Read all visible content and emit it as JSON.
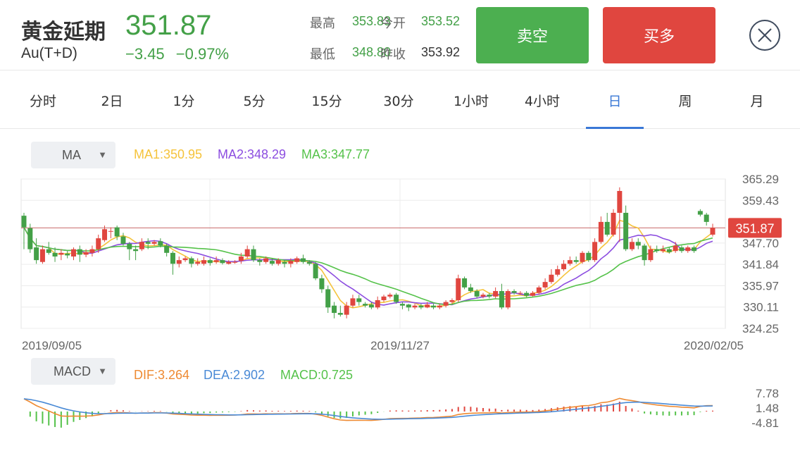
{
  "instrument": {
    "name": "黄金延期",
    "code": "Au(T+D)",
    "price": "351.87",
    "change": "−3.45",
    "change_pct": "−0.97%"
  },
  "stats": {
    "high_label": "最高",
    "high_value": "353.83",
    "open_label": "今开",
    "open_value": "353.52",
    "low_label": "最低",
    "low_value": "348.80",
    "prev_close_label": "昨收",
    "prev_close_value": "353.92"
  },
  "actions": {
    "sell_label": "卖空",
    "buy_label": "买多"
  },
  "tabs": [
    {
      "label": "分时"
    },
    {
      "label": "2日"
    },
    {
      "label": "1分"
    },
    {
      "label": "5分"
    },
    {
      "label": "15分"
    },
    {
      "label": "30分"
    },
    {
      "label": "1小时"
    },
    {
      "label": "4小时"
    },
    {
      "label": "日",
      "active": true
    },
    {
      "label": "周"
    },
    {
      "label": "月"
    }
  ],
  "ma_panel": {
    "selector": "MA",
    "ma1": "MA1:350.95",
    "ma2": "MA2:348.29",
    "ma3": "MA3:347.77",
    "y_ticks": [
      "365.29",
      "359.43",
      "347.70",
      "341.84",
      "335.97",
      "330.11",
      "324.25"
    ],
    "last_price_tag": "351.87",
    "dates": [
      "2019/09/05",
      "2019/11/27",
      "2020/02/05"
    ]
  },
  "macd_panel": {
    "selector": "MACD",
    "dif": "DIF:3.264",
    "dea": "DEA:2.902",
    "macd": "MACD:0.725",
    "y_ticks": [
      "7.78",
      "1.48",
      "-4.81"
    ]
  },
  "colors": {
    "up": "#e0463f",
    "down": "#43a047",
    "ma1": "#f5c33b",
    "ma2": "#8c4de0",
    "ma3": "#55c24a",
    "dif": "#ee8a32",
    "dea": "#4a8ad6",
    "macd": "#55c24a",
    "accent": "#3a78d6"
  },
  "chart_data": [
    {
      "type": "candlestick",
      "x_range": [
        "2019/09/05",
        "2020/02/05"
      ],
      "ylim": [
        324.25,
        365.29
      ],
      "last_price": 351.87,
      "series": [
        {
          "name": "MA1",
          "value": 350.95
        },
        {
          "name": "MA2",
          "value": 348.29
        },
        {
          "name": "MA3",
          "value": 347.77
        }
      ],
      "candles": [
        [
          355.2,
          352.0,
          356.0,
          346.0
        ],
        [
          351.8,
          346.0,
          353.0,
          345.0
        ],
        [
          346.5,
          343.0,
          349.0,
          342.0
        ],
        [
          342.5,
          346.0,
          347.0,
          342.0
        ],
        [
          346.0,
          345.0,
          348.0,
          344.5
        ],
        [
          345.0,
          344.0,
          346.5,
          342.5
        ],
        [
          344.5,
          345.0,
          346.0,
          343.0
        ],
        [
          344.8,
          344.3,
          345.5,
          343.5
        ],
        [
          344.0,
          346.0,
          346.5,
          343.0
        ],
        [
          346.0,
          344.5,
          347.0,
          342.5
        ],
        [
          344.5,
          345.2,
          346.0,
          343.8
        ],
        [
          345.0,
          346.0,
          347.0,
          344.0
        ],
        [
          346.0,
          349.0,
          350.0,
          345.0
        ],
        [
          348.5,
          351.5,
          352.5,
          348.0
        ],
        [
          351.0,
          351.0,
          352.0,
          349.0
        ],
        [
          352.0,
          349.5,
          352.5,
          348.5
        ],
        [
          349.5,
          347.5,
          350.5,
          347.0
        ],
        [
          347.5,
          346.0,
          348.0,
          343.0
        ],
        [
          346.0,
          345.5,
          347.0,
          343.0
        ],
        [
          346.0,
          348.0,
          349.0,
          345.5
        ],
        [
          348.0,
          347.5,
          349.0,
          346.0
        ],
        [
          347.5,
          348.0,
          348.5,
          347.0
        ],
        [
          348.2,
          347.0,
          349.0,
          346.5
        ],
        [
          347.0,
          345.0,
          347.5,
          344.0
        ],
        [
          345.0,
          342.0,
          345.5,
          339.0
        ],
        [
          342.0,
          343.0,
          344.0,
          341.0
        ],
        [
          343.0,
          343.5,
          344.0,
          342.5
        ],
        [
          343.5,
          342.0,
          344.0,
          341.0
        ],
        [
          342.0,
          342.5,
          343.5,
          341.5
        ],
        [
          342.0,
          343.0,
          344.0,
          341.5
        ],
        [
          343.0,
          342.2,
          343.5,
          341.5
        ],
        [
          342.5,
          343.0,
          344.0,
          342.0
        ],
        [
          343.0,
          342.2,
          343.5,
          341.8
        ],
        [
          342.0,
          342.5,
          343.0,
          341.8
        ],
        [
          342.3,
          342.5,
          343.0,
          342.0
        ],
        [
          342.8,
          344.0,
          345.0,
          342.0
        ],
        [
          344.0,
          346.0,
          347.0,
          343.5
        ],
        [
          346.0,
          343.0,
          347.0,
          342.5
        ],
        [
          343.0,
          342.5,
          343.5,
          341.5
        ],
        [
          342.5,
          343.5,
          344.0,
          342.0
        ],
        [
          342.8,
          342.0,
          343.5,
          341.5
        ],
        [
          342.0,
          343.0,
          343.5,
          341.5
        ],
        [
          342.5,
          342.0,
          343.0,
          341.0
        ],
        [
          342.0,
          342.8,
          343.5,
          341.0
        ],
        [
          342.5,
          343.5,
          344.0,
          342.0
        ],
        [
          343.5,
          342.5,
          344.5,
          342.0
        ],
        [
          342.5,
          342.0,
          343.0,
          341.5
        ],
        [
          342.0,
          338.0,
          342.5,
          337.5
        ],
        [
          338.0,
          335.0,
          339.0,
          334.0
        ],
        [
          335.0,
          330.0,
          336.0,
          328.5
        ],
        [
          330.5,
          328.5,
          331.5,
          327.0
        ],
        [
          328.5,
          328.0,
          330.5,
          327.5
        ],
        [
          328.0,
          330.5,
          331.5,
          327.0
        ],
        [
          330.5,
          332.5,
          333.5,
          330.0
        ],
        [
          332.5,
          331.5,
          333.5,
          330.5
        ],
        [
          331.0,
          330.5,
          331.5,
          330.0
        ],
        [
          330.8,
          330.0,
          331.5,
          329.5
        ],
        [
          330.0,
          332.0,
          333.0,
          329.5
        ],
        [
          332.0,
          333.0,
          333.5,
          331.5
        ],
        [
          333.0,
          333.5,
          334.0,
          332.5
        ],
        [
          333.5,
          331.5,
          334.0,
          331.0
        ],
        [
          331.0,
          330.5,
          331.5,
          329.5
        ],
        [
          330.8,
          330.0,
          331.0,
          329.0
        ],
        [
          330.0,
          330.5,
          331.0,
          329.5
        ],
        [
          330.5,
          330.0,
          331.0,
          329.5
        ],
        [
          330.0,
          330.8,
          331.5,
          329.8
        ],
        [
          330.5,
          330.0,
          331.0,
          329.5
        ],
        [
          330.0,
          330.5,
          331.0,
          329.5
        ],
        [
          330.5,
          331.5,
          332.0,
          330.0
        ],
        [
          331.5,
          332.0,
          332.5,
          331.0
        ],
        [
          332.0,
          338.0,
          339.0,
          331.5
        ],
        [
          338.0,
          335.5,
          338.5,
          335.0
        ],
        [
          335.5,
          334.5,
          336.5,
          334.0
        ],
        [
          334.5,
          333.0,
          335.0,
          332.5
        ],
        [
          333.0,
          333.5,
          334.0,
          332.5
        ],
        [
          333.5,
          333.0,
          334.0,
          332.5
        ],
        [
          333.0,
          334.5,
          335.5,
          332.5
        ],
        [
          334.5,
          330.0,
          336.5,
          329.5
        ],
        [
          330.0,
          334.5,
          335.0,
          329.5
        ],
        [
          334.5,
          334.0,
          335.0,
          333.5
        ],
        [
          334.0,
          334.0,
          334.5,
          333.5
        ],
        [
          334.0,
          333.2,
          334.5,
          332.8
        ],
        [
          333.2,
          334.0,
          334.5,
          333.0
        ],
        [
          334.0,
          335.5,
          336.0,
          333.5
        ],
        [
          335.5,
          337.0,
          338.0,
          335.0
        ],
        [
          337.0,
          339.0,
          340.5,
          336.5
        ],
        [
          339.0,
          340.5,
          341.5,
          338.5
        ],
        [
          340.5,
          342.0,
          343.0,
          340.0
        ],
        [
          342.0,
          343.0,
          344.0,
          341.5
        ],
        [
          343.0,
          342.5,
          344.0,
          342.0
        ],
        [
          342.5,
          345.0,
          345.5,
          342.0
        ],
        [
          345.0,
          343.0,
          345.5,
          342.5
        ],
        [
          343.0,
          348.0,
          349.0,
          342.5
        ],
        [
          348.0,
          353.5,
          355.0,
          347.5
        ],
        [
          353.5,
          350.0,
          356.0,
          349.5
        ],
        [
          350.0,
          356.0,
          357.0,
          349.5
        ],
        [
          356.0,
          362.0,
          363.0,
          348.0
        ],
        [
          356.0,
          346.0,
          358.0,
          345.5
        ],
        [
          346.0,
          348.0,
          349.0,
          345.5
        ],
        [
          348.0,
          347.0,
          349.0,
          346.0
        ],
        [
          347.0,
          343.0,
          347.5,
          341.5
        ],
        [
          343.0,
          346.0,
          347.0,
          342.5
        ],
        [
          346.0,
          345.5,
          347.0,
          345.0
        ],
        [
          345.5,
          346.0,
          347.0,
          345.0
        ],
        [
          346.0,
          345.2,
          346.5,
          344.8
        ],
        [
          345.5,
          347.0,
          348.0,
          345.0
        ],
        [
          346.5,
          345.5,
          347.0,
          345.0
        ],
        [
          345.5,
          346.5,
          347.0,
          345.0
        ],
        [
          346.5,
          345.5,
          347.0,
          345.0
        ],
        [
          356.5,
          355.5,
          357.0,
          355.0
        ],
        [
          355.5,
          353.5,
          356.0,
          352.5
        ],
        [
          350.0,
          351.87,
          353.0,
          349.5
        ]
      ]
    },
    {
      "type": "bar",
      "name": "MACD",
      "ylim": [
        -4.81,
        7.78
      ],
      "series": [
        {
          "name": "DIF",
          "value": 3.264
        },
        {
          "name": "DEA",
          "value": 2.902
        },
        {
          "name": "MACD",
          "value": 0.725
        }
      ]
    }
  ]
}
